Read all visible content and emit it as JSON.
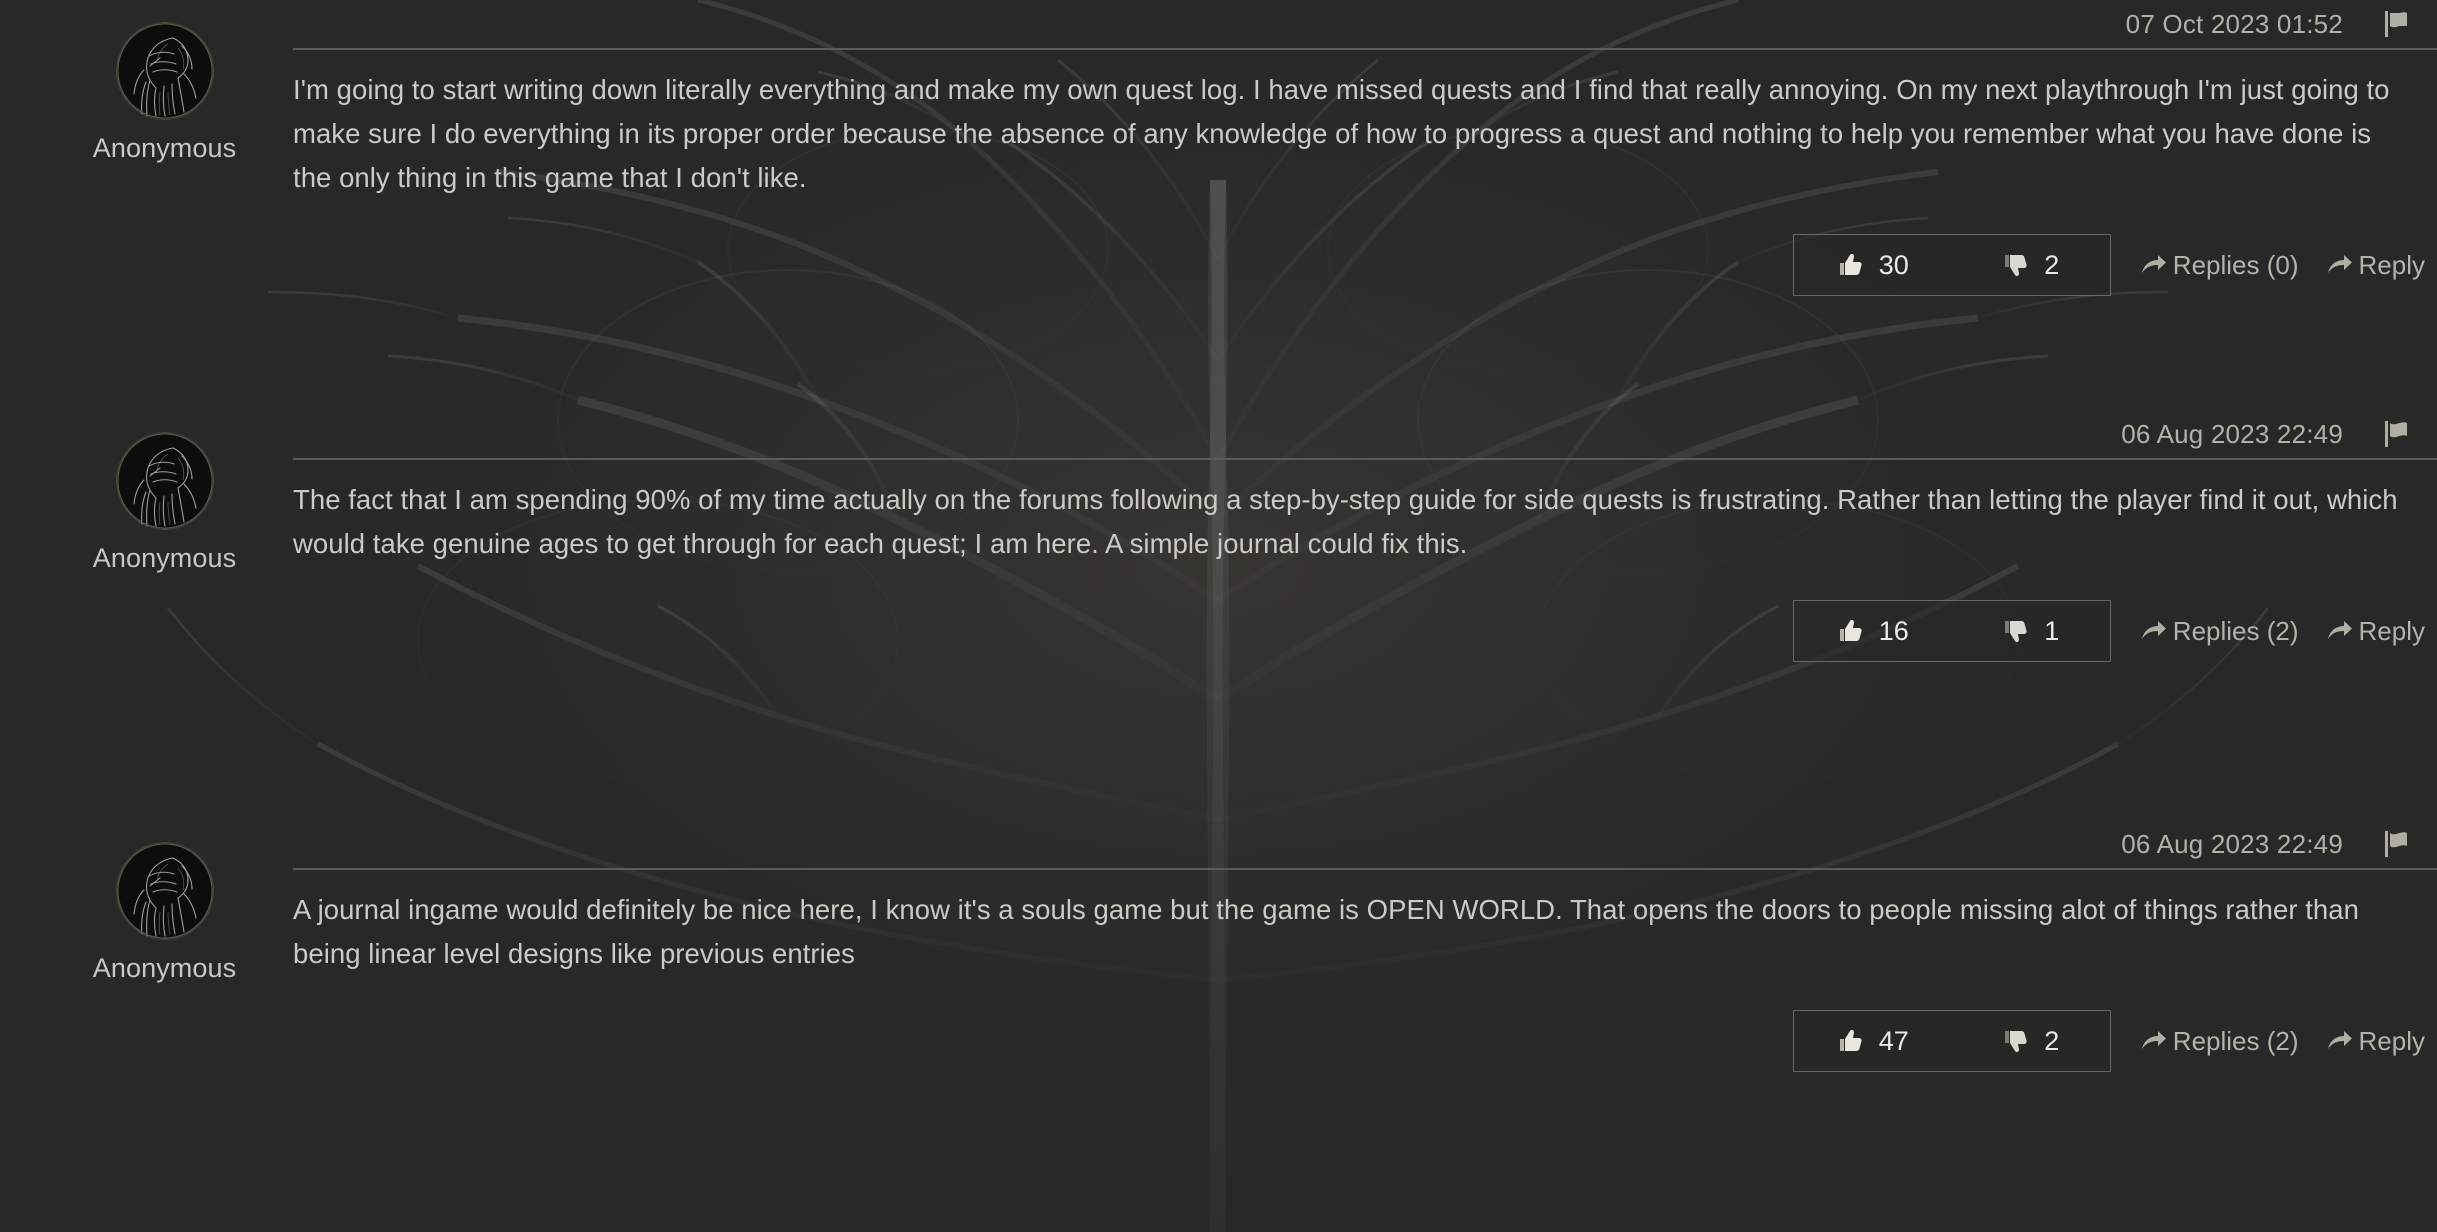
{
  "page": {
    "background_color": "#282a2a",
    "text_color": "#cbcac4",
    "accent_color": "#b3b0a6",
    "border_color": "#6a685f"
  },
  "labels": {
    "reply": "Reply",
    "flag_icon": "flag-icon",
    "thumbs_up_icon": "thumbs-up-icon",
    "thumbs_down_icon": "thumbs-down-icon",
    "arrow_icon": "reply-arrow-icon",
    "avatar_icon": "knight-avatar-icon"
  },
  "comments": [
    {
      "author": "Anonymous",
      "timestamp": "07 Oct 2023 01:52",
      "text": "I'm going to start writing down literally everything and make my own quest log. I have missed quests and I find that really annoying. On my next playthrough I'm just going to make sure I do everything in its proper order because the absence of any knowledge of how to progress a quest and nothing to help you remember what you have done is the only thing in this game that I don't like.",
      "upvotes": "30",
      "downvotes": "2",
      "replies_label": "Replies (0)",
      "reply_label": "Reply"
    },
    {
      "author": "Anonymous",
      "timestamp": "06 Aug 2023 22:49",
      "text": "The fact that I am spending 90% of my time actually on the forums following a step-by-step guide for side quests is frustrating. Rather than letting the player find it out, which would take genuine ages to get through for each quest; I am here. A simple journal could fix this.",
      "upvotes": "16",
      "downvotes": "1",
      "replies_label": "Replies (2)",
      "reply_label": "Reply"
    },
    {
      "author": "Anonymous",
      "timestamp": "06 Aug 2023 22:49",
      "text": "A journal ingame would definitely be nice here, I know it's a souls game but the game is OPEN WORLD. That opens the doors to people missing alot of things rather than being linear level designs like previous entries",
      "upvotes": "47",
      "downvotes": "2",
      "replies_label": "Replies (2)",
      "reply_label": "Reply"
    }
  ]
}
